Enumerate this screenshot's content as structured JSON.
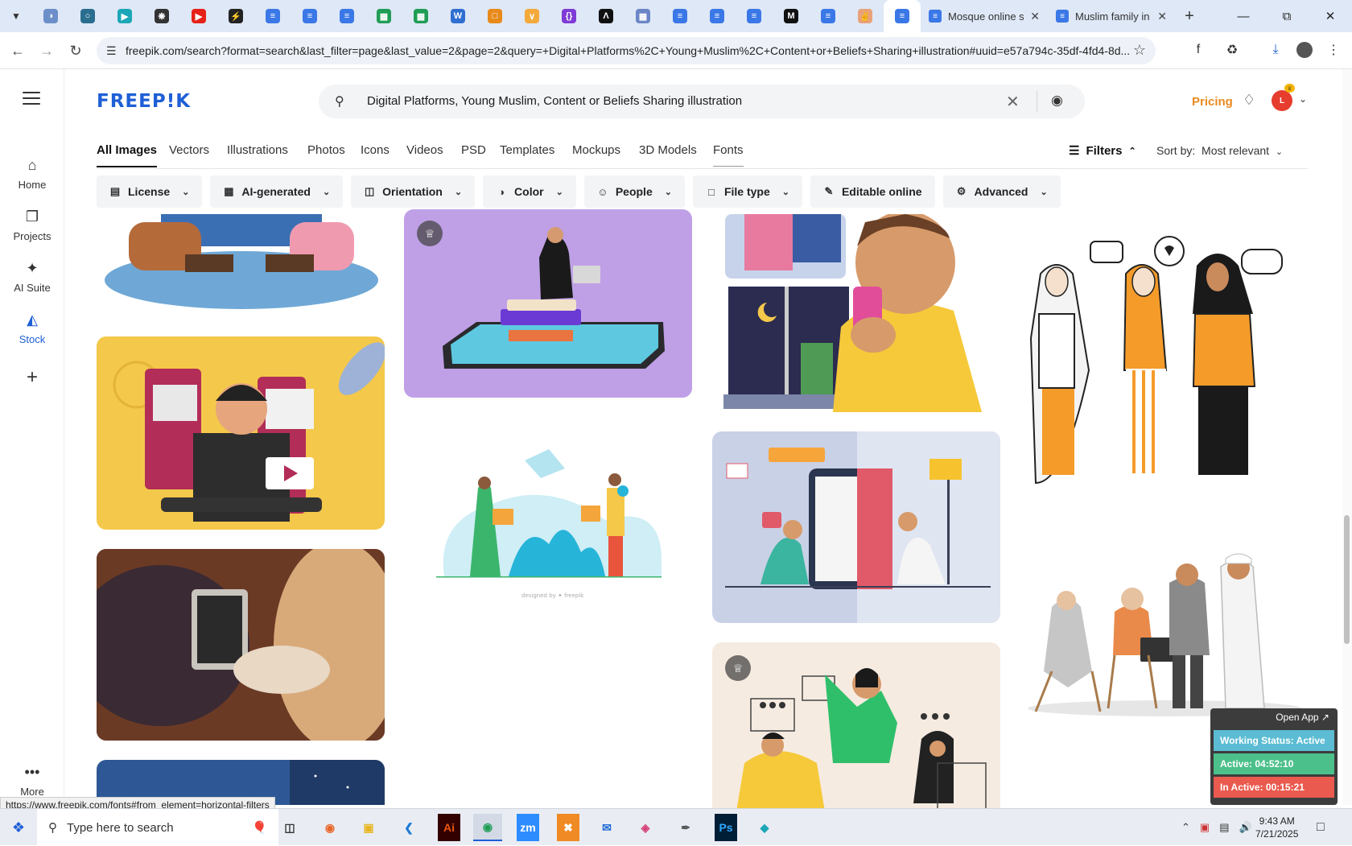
{
  "browser": {
    "tabs": [
      {
        "title": "Mosque online s",
        "active": true
      },
      {
        "title": "Muslim family in",
        "active": false
      }
    ],
    "new_tab": "+",
    "url": "freepik.com/search?format=search&last_filter=page&last_value=2&page=2&query=+Digital+Platforms%2C+Young+Muslim%2C+Content+or+Beliefs+Sharing+illustration#uuid=e57a794c-35df-4fd4-8d...",
    "status_url": "https://www.freepik.com/fonts#from_element=horizontal-filters"
  },
  "sidebar": {
    "items": [
      {
        "label": "Home",
        "icon": "house-icon"
      },
      {
        "label": "Projects",
        "icon": "folder-icon"
      },
      {
        "label": "AI Suite",
        "icon": "sparkle-icon"
      },
      {
        "label": "Stock",
        "icon": "stock-icon"
      },
      {
        "label": "",
        "icon": "plus-icon"
      },
      {
        "label": "More",
        "icon": "more-icon"
      }
    ]
  },
  "header": {
    "logo": "FREEP!K",
    "search_query": "Digital Platforms, Young Muslim, Content or Beliefs Sharing illustration",
    "pricing": "Pricing"
  },
  "type_tabs": [
    "All Images",
    "Vectors",
    "Illustrations",
    "Photos",
    "Icons",
    "Videos",
    "PSD",
    "Templates",
    "Mockups",
    "3D Models",
    "Fonts"
  ],
  "filters_label": "Filters",
  "sort": {
    "label": "Sort by:",
    "value": "Most relevant"
  },
  "chips": [
    "License",
    "AI-generated",
    "Orientation",
    "Color",
    "People",
    "File type",
    "Editable online",
    "Advanced"
  ],
  "watermark": "designed by ✦ freepik",
  "widget": {
    "open_app": "Open App ↗",
    "working_status": "Working Status: Active",
    "active": "Active: 04:52:10",
    "inactive": "In Active: 00:15:21"
  },
  "taskbar": {
    "search_placeholder": "Type here to search",
    "time": "9:43 AM",
    "date": "7/21/2025"
  },
  "colors": {
    "brand": "#1f5fd6",
    "pricing": "#e98a20"
  }
}
